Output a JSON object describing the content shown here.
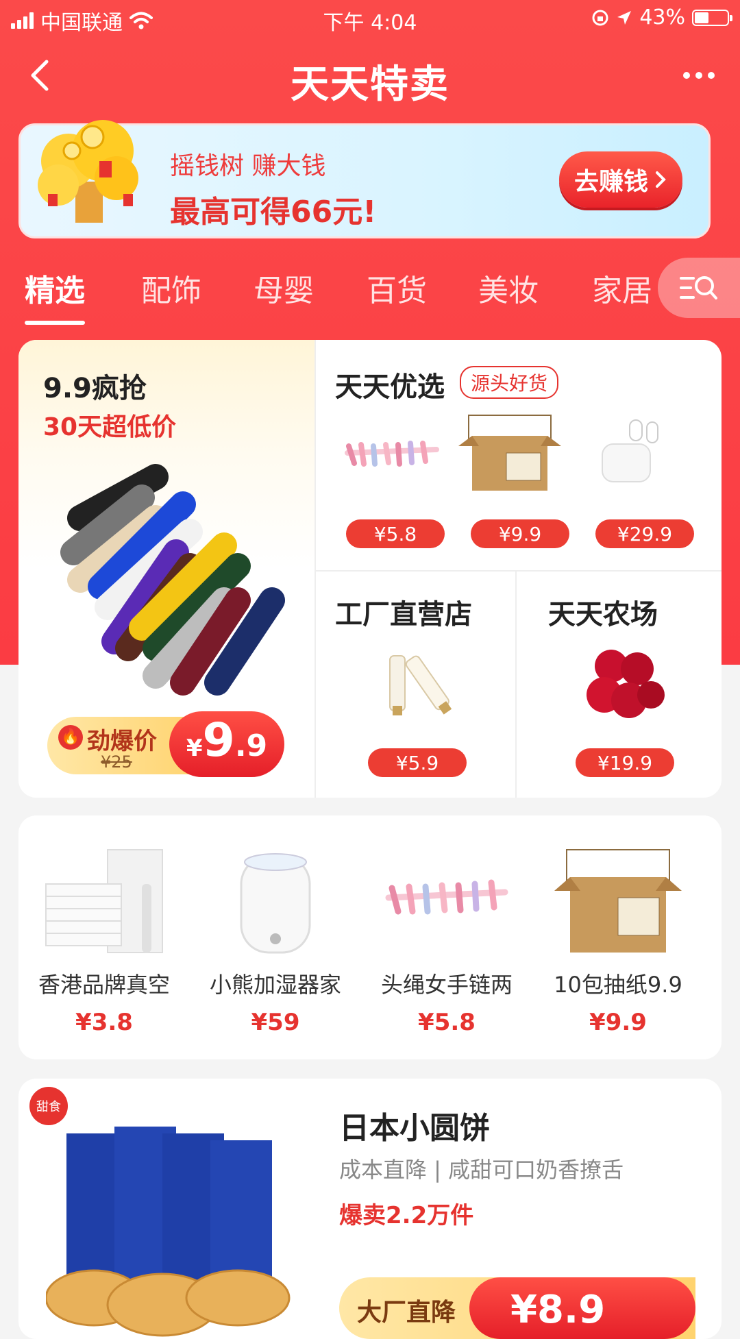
{
  "status_bar": {
    "carrier": "中国联通",
    "time": "下午 4:04",
    "battery": "43%",
    "battery_level": 0.43
  },
  "header": {
    "title": "天天特卖"
  },
  "banner": {
    "line1": "摇钱树 赚大钱",
    "line2": "最高可得66元!",
    "button": "去赚钱"
  },
  "tabs": [
    {
      "label": "精选"
    },
    {
      "label": "配饰"
    },
    {
      "label": "母婴"
    },
    {
      "label": "百货"
    },
    {
      "label": "美妆"
    },
    {
      "label": "家居"
    }
  ],
  "flash": {
    "title": "9.9疯抢",
    "subtitle": "30天超低价",
    "tag": "劲爆价",
    "original_price": "¥25",
    "price_symbol": "¥",
    "price_int": "9",
    "price_dec": ".9"
  },
  "premium": {
    "title": "天天优选",
    "tag": "源头好货",
    "items": [
      {
        "price": "¥5.8"
      },
      {
        "price": "¥9.9"
      },
      {
        "price": "¥29.9"
      }
    ]
  },
  "factory": {
    "title": "工厂直营店",
    "price": "¥5.9"
  },
  "farm": {
    "title": "天天农场",
    "price": "¥19.9"
  },
  "products": [
    {
      "name": "香港品牌真空",
      "price": "¥3.8"
    },
    {
      "name": "小熊加湿器家",
      "price": "¥59"
    },
    {
      "name": "头绳女手链两",
      "price": "¥5.8"
    },
    {
      "name": "10包抽纸9.9",
      "price": "¥9.9"
    }
  ],
  "feature": {
    "badge": "甜食",
    "title": "日本小圆饼",
    "desc": "成本直降 | 咸甜可口奶香撩舌",
    "sold": "爆卖2.2万件",
    "bar_text": "大厂直降",
    "bar_price": "¥8.9"
  },
  "colors": {
    "brand_red": "#fb4a4a",
    "price_red": "#e6332f",
    "gold": "#ffd36e"
  },
  "icons": [
    "signal-icon",
    "wifi-icon",
    "lock-rotation-icon",
    "location-icon",
    "battery-icon",
    "back-icon",
    "more-icon",
    "chevron-right-icon",
    "category-search-icon",
    "fire-icon"
  ]
}
